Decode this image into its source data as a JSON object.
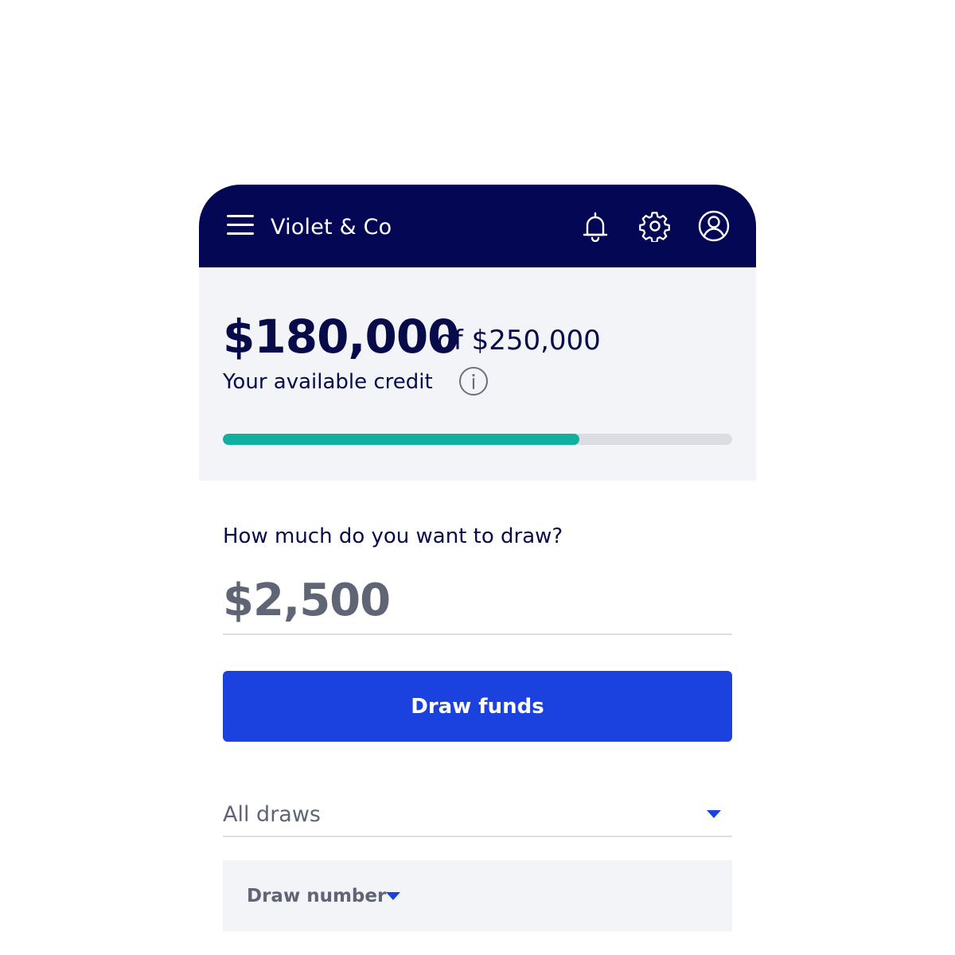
{
  "header": {
    "brand": "Violet & Co",
    "icons": [
      "menu-icon",
      "bell-icon",
      "gear-icon",
      "user-icon"
    ]
  },
  "credit": {
    "available": "$180,000",
    "of_total": "of $250,000",
    "label": "Your available credit",
    "used_fraction": 0.7
  },
  "draw": {
    "question": "How much do you want to draw?",
    "amount": "$2,500",
    "button_label": "Draw funds"
  },
  "filter": {
    "selected": "All draws"
  },
  "table": {
    "columns": [
      "Draw number"
    ]
  },
  "colors": {
    "header_bg": "#040854",
    "accent": "#1b41de",
    "progress": "#0fb0a0",
    "panel_bg": "#f3f4f8"
  }
}
